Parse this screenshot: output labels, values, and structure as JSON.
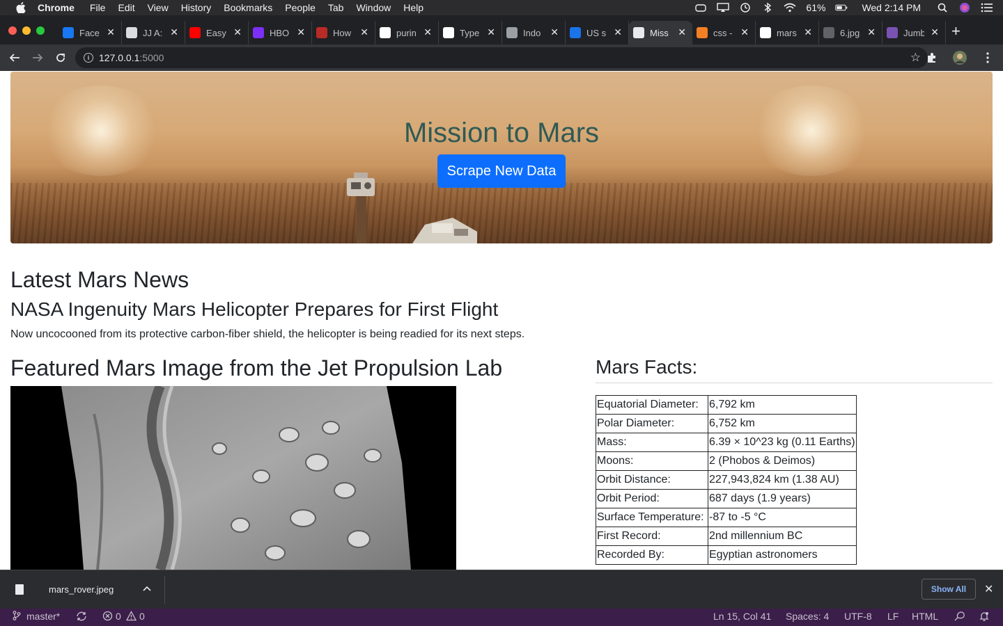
{
  "menubar": {
    "app": "Chrome",
    "items": [
      "File",
      "Edit",
      "View",
      "History",
      "Bookmarks",
      "People",
      "Tab",
      "Window",
      "Help"
    ],
    "battery": "61%",
    "clock": "Wed 2:14 PM"
  },
  "tabs": [
    {
      "title": "Face",
      "icon": "facebook-icon",
      "color": "#1877f2"
    },
    {
      "title": "JJ A:",
      "icon": "trello-icon",
      "color": "#dadce0"
    },
    {
      "title": "Easy",
      "icon": "youtube-icon",
      "color": "#ff0000"
    },
    {
      "title": "HBO",
      "icon": "hbo-icon",
      "color": "#7b2ff7"
    },
    {
      "title": "How",
      "icon": "quora-icon",
      "color": "#b92b27"
    },
    {
      "title": "purin",
      "icon": "google-icon",
      "color": "#ffffff"
    },
    {
      "title": "Type",
      "icon": "news-icon",
      "color": "#ffffff"
    },
    {
      "title": "Indo",
      "icon": "loading-icon",
      "color": "#9aa0a6"
    },
    {
      "title": "US s",
      "icon": "g-icon",
      "color": "#1a73e8"
    },
    {
      "title": "Miss",
      "icon": "globe-icon",
      "color": "#e8eaed"
    },
    {
      "title": "css -",
      "icon": "stackoverflow-icon",
      "color": "#f48024"
    },
    {
      "title": "mars",
      "icon": "google-icon",
      "color": "#ffffff"
    },
    {
      "title": "6.jpg",
      "icon": "globe-icon",
      "color": "#5f6368"
    },
    {
      "title": "Jumb",
      "icon": "bootstrap-icon",
      "color": "#7952b3"
    }
  ],
  "active_tab_index": 9,
  "omnibox": {
    "host": "127.0.0.1",
    "port": ":5000"
  },
  "page": {
    "jumbo_title": "Mission to Mars",
    "scrape_button": "Scrape New Data",
    "news_heading": "Latest Mars News",
    "news_title": "NASA Ingenuity Mars Helicopter Prepares for First Flight",
    "news_paragraph": "Now uncocooned from its protective carbon-fiber shield, the helicopter is being readied for its next steps.",
    "featured_heading": "Featured Mars Image from the Jet Propulsion Lab",
    "facts_heading": "Mars Facts:",
    "facts": [
      {
        "label": "Equatorial Diameter:",
        "value": "6,792 km"
      },
      {
        "label": "Polar Diameter:",
        "value": "6,752 km"
      },
      {
        "label": "Mass:",
        "value": "6.39 × 10^23 kg (0.11 Earths)"
      },
      {
        "label": "Moons:",
        "value": "2 (Phobos & Deimos)"
      },
      {
        "label": "Orbit Distance:",
        "value": "227,943,824 km (1.38 AU)"
      },
      {
        "label": "Orbit Period:",
        "value": "687 days (1.9 years)"
      },
      {
        "label": "Surface Temperature:",
        "value": "-87 to -5 °C"
      },
      {
        "label": "First Record:",
        "value": "2nd millennium BC"
      },
      {
        "label": "Recorded By:",
        "value": "Egyptian astronomers"
      }
    ]
  },
  "download": {
    "filename": "mars_rover.jpeg",
    "show_all": "Show All"
  },
  "statusbar": {
    "branch": "master*",
    "errors": "0",
    "warnings": "0",
    "position": "Ln 15, Col 41",
    "spaces": "Spaces: 4",
    "encoding": "UTF-8",
    "eol": "LF",
    "language": "HTML"
  }
}
